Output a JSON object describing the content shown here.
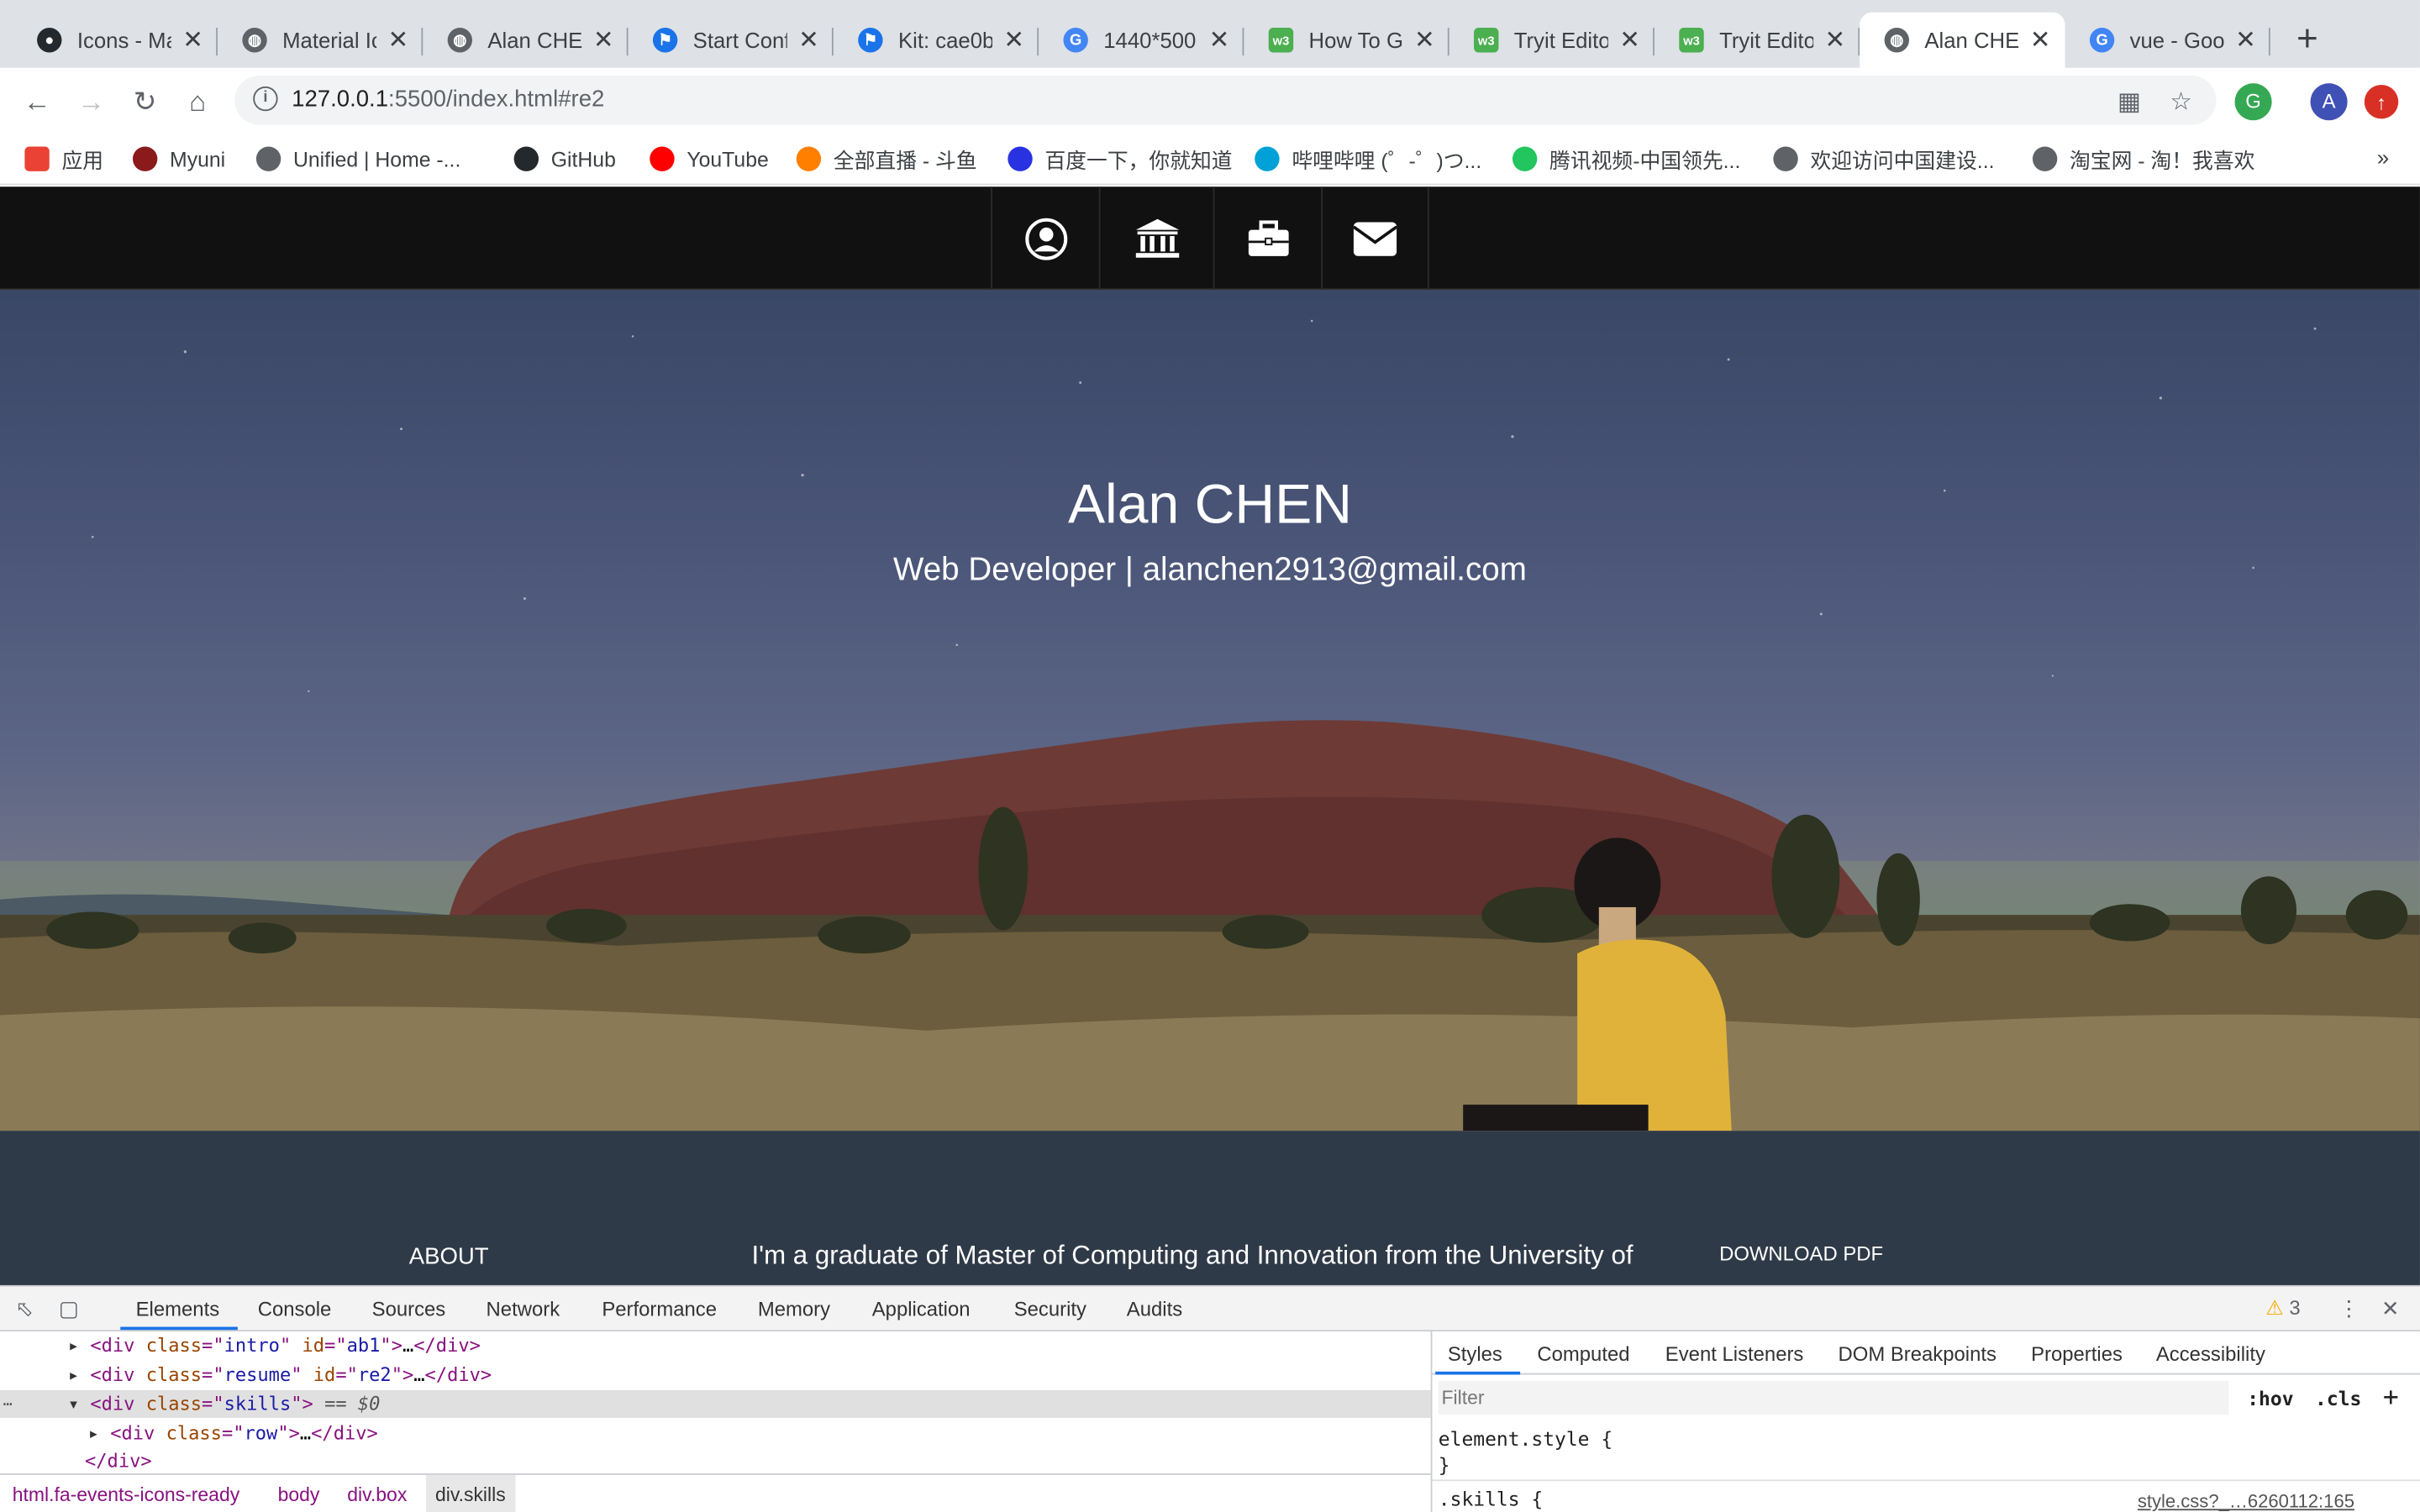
{
  "tabs": [
    {
      "title": "Icons - Ma",
      "icon": "github-icon",
      "color": "#24292e"
    },
    {
      "title": "Material Ic",
      "icon": "globe-icon",
      "color": "#5f6368"
    },
    {
      "title": "Alan CHEN",
      "icon": "globe-icon",
      "color": "#5f6368"
    },
    {
      "title": "Start Conf",
      "icon": "flag-icon",
      "color": "#1a73e8"
    },
    {
      "title": "Kit: cae0b",
      "icon": "flag-icon",
      "color": "#1a73e8"
    },
    {
      "title": "1440*500",
      "icon": "google-icon",
      "color": "#4285f4"
    },
    {
      "title": "How To G",
      "icon": "w3-icon",
      "color": "#4caf50"
    },
    {
      "title": "Tryit Edito",
      "icon": "w3-icon",
      "color": "#4caf50"
    },
    {
      "title": "Tryit Edito",
      "icon": "w3-icon",
      "color": "#4caf50"
    },
    {
      "title": "Alan CHEN",
      "icon": "globe-icon",
      "color": "#5f6368",
      "active": true
    },
    {
      "title": "vue - Goo",
      "icon": "google-icon",
      "color": "#4285f4"
    }
  ],
  "toolbar": {
    "url_host": "127.0.0.1",
    "url_rest": ":5500/index.html#re2"
  },
  "bookmarks": [
    {
      "label": "应用",
      "color": "#ea4335"
    },
    {
      "label": "Myuni",
      "color": "#8b1a1a"
    },
    {
      "label": "Unified | Home -...",
      "color": "#5f6368"
    },
    {
      "label": "GitHub",
      "color": "#24292e"
    },
    {
      "label": "YouTube",
      "color": "#ff0000"
    },
    {
      "label": "全部直播 - 斗鱼",
      "color": "#ff7f00"
    },
    {
      "label": "百度一下，你就知道",
      "color": "#2932e1"
    },
    {
      "label": "哔哩哔哩 (゜-゜)つ...",
      "color": "#00a1d6"
    },
    {
      "label": "腾讯视频-中国领先...",
      "color": "#22c55e"
    },
    {
      "label": "欢迎访问中国建设...",
      "color": "#5f6368"
    },
    {
      "label": "淘宝网 - 淘！我喜欢",
      "color": "#5f6368"
    }
  ],
  "site": {
    "name": "Alan CHEN",
    "tagline": "Web Developer | alanchen2913@gmail.com",
    "nav_icons": [
      "user-circle-icon",
      "university-icon",
      "briefcase-icon",
      "envelope-icon"
    ],
    "about_label": "ABOUT",
    "about_text": "I'm a graduate of Master of Computing and Innovation from the University of",
    "download_label": "DOWNLOAD PDF"
  },
  "devtools": {
    "tabs": [
      "Elements",
      "Console",
      "Sources",
      "Network",
      "Performance",
      "Memory",
      "Application",
      "Security",
      "Audits"
    ],
    "warnings": "3",
    "dom_lines": [
      {
        "cls": "intro",
        "id": "ab1"
      },
      {
        "cls": "resume",
        "id": "re2"
      },
      {
        "cls": "skills",
        "selected": true
      },
      {
        "cls": "row"
      }
    ],
    "selected_suffix": "== $0",
    "closing_div": "</div>",
    "breadcrumbs": [
      "html.fa-events-icons-ready",
      "body",
      "div.box",
      "div.skills"
    ],
    "style_tabs": [
      "Styles",
      "Computed",
      "Event Listeners",
      "DOM Breakpoints",
      "Properties",
      "Accessibility"
    ],
    "filter_placeholder": "Filter",
    "hov": ":hov",
    "cls_btn": ".cls",
    "element_style": "element.style {",
    "close_brace": "}",
    "skills_rule": ".skills {",
    "source_link": "style.css?_…6260112:165"
  }
}
